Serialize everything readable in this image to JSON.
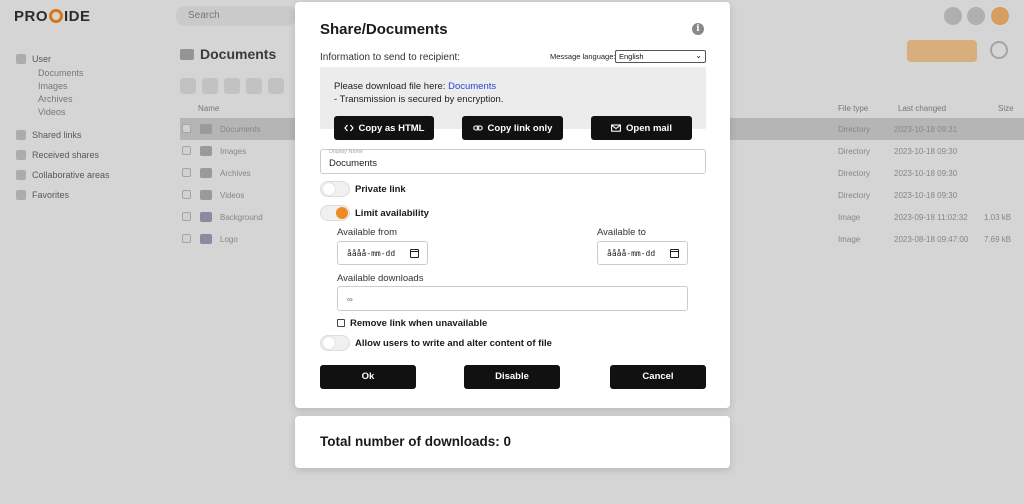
{
  "app": {
    "logo": "PROXIDE",
    "search_placeholder": "Search",
    "page_title": "Documents",
    "sidebar": [
      {
        "label": "User"
      },
      {
        "label": "Documents"
      },
      {
        "label": "Images"
      },
      {
        "label": "Archives"
      },
      {
        "label": "Videos"
      },
      {
        "label": "Shared links"
      },
      {
        "label": "Received shares"
      },
      {
        "label": "Collaborative areas"
      },
      {
        "label": "Favorites"
      }
    ],
    "columns": [
      "Name",
      "File type",
      "Last changed",
      "Size"
    ],
    "rows": [
      {
        "name": "Documents",
        "type": "Directory",
        "date": "2023-10-18 09:31",
        "size": "",
        "selected": true
      },
      {
        "name": "Images",
        "type": "Directory",
        "date": "2023-10-18 09:30",
        "size": ""
      },
      {
        "name": "Archives",
        "type": "Directory",
        "date": "2023-10-18 09:30",
        "size": ""
      },
      {
        "name": "Videos",
        "type": "Directory",
        "date": "2023-10-18 09:30",
        "size": ""
      },
      {
        "name": "Background",
        "type": "Image",
        "date": "2023-09-18 11:02:32",
        "size": "1.03 kB"
      },
      {
        "name": "Logo",
        "type": "Image",
        "date": "2023-08-18 09:47:00",
        "size": "7.69 kB"
      }
    ]
  },
  "dialog": {
    "title": "Share/Documents",
    "info_icon": "i",
    "info_label": "Information to send to recipient:",
    "language_label": "Message language:",
    "language_value": "English",
    "message_prefix": "Please download file here: ",
    "message_link": "Documents",
    "message_line2": "- Transmission is secured by encryption.",
    "copy_html_label": "Copy as HTML",
    "copy_link_label": "Copy link only",
    "open_mail_label": "Open mail",
    "display_name_label": "Display Name",
    "display_name_value": "Documents",
    "private_link_label": "Private link",
    "private_link_on": false,
    "limit_availability_label": "Limit availability",
    "limit_availability_on": true,
    "available_from_label": "Available from",
    "available_from_value": "åååå-mm-dd",
    "available_to_label": "Available to",
    "available_to_value": "åååå-mm-dd",
    "available_downloads_label": "Available downloads",
    "available_downloads_value": "∞",
    "remove_link_label": "Remove link when unavailable",
    "remove_link_checked": false,
    "allow_write_label": "Allow users to write and alter content of file",
    "allow_write_on": false,
    "ok_label": "Ok",
    "disable_label": "Disable",
    "cancel_label": "Cancel"
  },
  "stats": {
    "total_downloads_label": "Total number of downloads: 0"
  },
  "colors": {
    "accent": "#f08a24",
    "button": "#111111",
    "link": "#2d3fd6"
  }
}
